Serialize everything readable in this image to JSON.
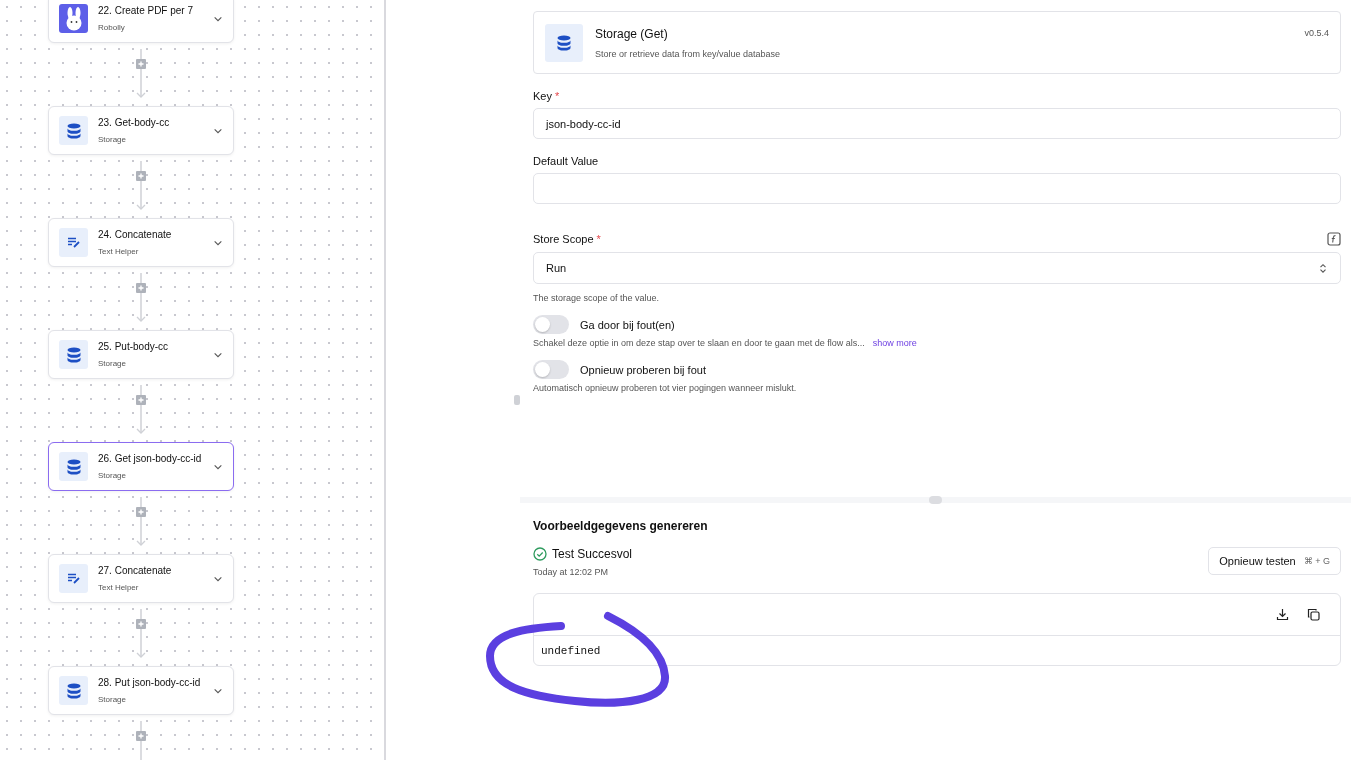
{
  "flow": {
    "steps": [
      {
        "title": "22. Create PDF per 7",
        "subtitle": "Robolly",
        "kind": "rabbit",
        "selected": false
      },
      {
        "title": "23. Get-body-cc",
        "subtitle": "Storage",
        "kind": "storage",
        "selected": false
      },
      {
        "title": "24. Concatenate",
        "subtitle": "Text Helper",
        "kind": "text",
        "selected": false
      },
      {
        "title": "25. Put-body-cc",
        "subtitle": "Storage",
        "kind": "storage",
        "selected": false
      },
      {
        "title": "26. Get json-body-cc-id",
        "subtitle": "Storage",
        "kind": "storage",
        "selected": true
      },
      {
        "title": "27. Concatenate",
        "subtitle": "Text Helper",
        "kind": "text",
        "selected": false
      },
      {
        "title": "28. Put json-body-cc-id",
        "subtitle": "Storage",
        "kind": "storage",
        "selected": false
      }
    ]
  },
  "piece": {
    "name": "Storage (Get)",
    "description": "Store or retrieve data from key/value database",
    "version": "v0.5.4"
  },
  "fields": [
    {
      "kind": "input",
      "label": "Key",
      "required_mark": "*",
      "value": "json-body-cc-id"
    },
    {
      "kind": "input",
      "label": "Default Value"
    },
    {
      "kind": "select",
      "label": "Store Scope",
      "required_mark": "*",
      "value": "Run",
      "help": "The storage scope of the value."
    }
  ],
  "toggles": [
    {
      "label": "Ga door bij fout(en)",
      "on": false,
      "description": "Schakel deze optie in om deze stap over te slaan en door te gaan met de flow als...",
      "link": "show more"
    },
    {
      "label": "Opnieuw proberen bij fout",
      "on": false,
      "description": "Automatisch opnieuw proberen tot vier pogingen wanneer mislukt."
    }
  ],
  "test": {
    "title": "Voorbeeldgegevens genereren",
    "status": "Test Succesvol",
    "time": "Today at 12:02 PM",
    "button": "Opnieuw testen",
    "shortcut": "⌘ + G",
    "output": "undefined"
  }
}
